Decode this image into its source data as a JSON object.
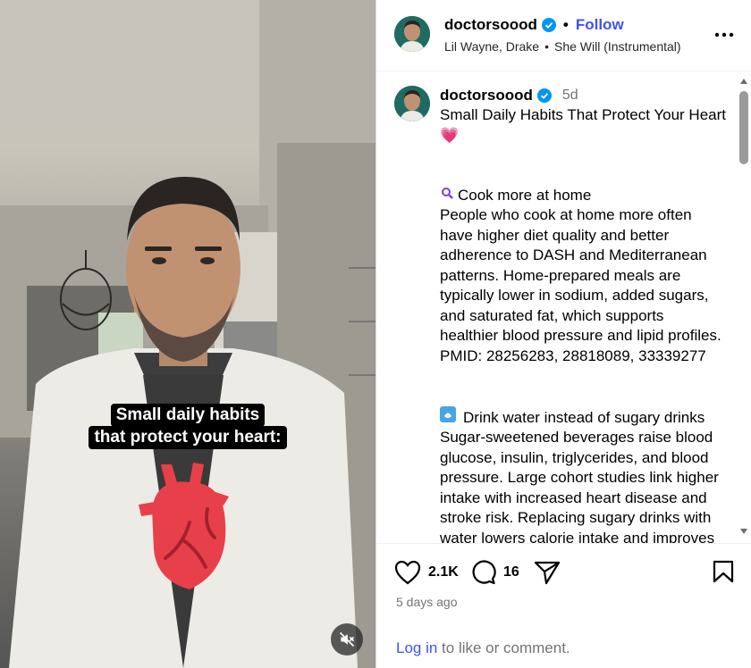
{
  "video": {
    "caption_line1": "Small daily habits",
    "caption_line2": "that protect your heart:",
    "mute_icon": "speaker-muted-icon"
  },
  "header": {
    "username": "doctorsoood",
    "follow_label": "Follow",
    "dot": "•",
    "audio_artist": "Lil Wayne, Drake",
    "audio_title": "She Will (Instrumental)"
  },
  "post": {
    "username": "doctorsoood",
    "time": "5d",
    "caption_title": "Small Daily Habits That Protect Your Heart 💗",
    "habit1_title": "Cook more at home",
    "habit1_body": "People who cook at home more often have higher diet quality and better adherence to DASH and Mediterranean patterns. Home-prepared meals are typically lower in sodium, added sugars, and saturated fat, which supports healthier blood pressure and lipid profiles. PMID: 28256283, 28818089, 33339277",
    "habit2_title": "Drink water instead of sugary drinks",
    "habit2_body": "Sugar-sweetened beverages raise blood glucose, insulin, triglycerides, and blood pressure. Large cohort studies link higher intake with increased heart disease and stroke risk. Replacing sugary drinks with water lowers calorie intake and improves triglycerides and"
  },
  "actions": {
    "likes": "2.1K",
    "comments": "16",
    "posted": "5 days ago",
    "login_link": "Log in",
    "login_rest": " to like or comment."
  },
  "colors": {
    "accent": "#4150f7",
    "verified": "#0095f6",
    "heart": "#e0306a"
  }
}
